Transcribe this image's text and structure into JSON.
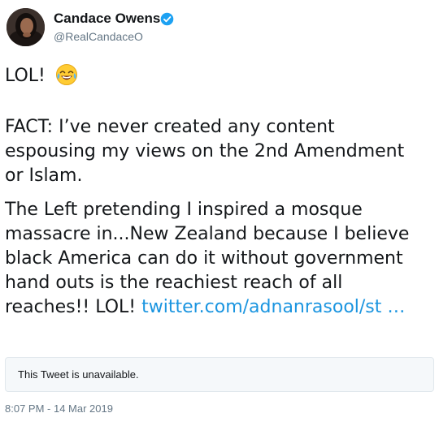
{
  "author": {
    "display_name": "Candace Owens",
    "handle": "@RealCandaceO",
    "verified": true
  },
  "icons": {
    "verified": "verified-badge-icon",
    "emoji": "tears-of-joy-emoji"
  },
  "tweet": {
    "line1": "LOL!",
    "paragraph1": [
      "FACT: I’ve never created any content",
      "espousing my views on the 2nd Amendment",
      "or Islam."
    ],
    "paragraph2": [
      "The Left pretending I inspired a mosque",
      "massacre in...New Zealand because I believe",
      "black America can do it without government",
      "hand outs is the reachiest reach of all"
    ],
    "last_line_text": "reaches!! LOL!",
    "link_text": "twitter.com/adnanrasool/st …"
  },
  "quoted_tweet": {
    "status_text": "This Tweet is unavailable."
  },
  "timestamp": "8:07 PM - 14 Mar 2019",
  "colors": {
    "link": "#1b95e0",
    "verified": "#1da1f2",
    "secondary_text": "#657786",
    "card_border": "#e1e8ed",
    "card_background": "#f5f8fa"
  }
}
